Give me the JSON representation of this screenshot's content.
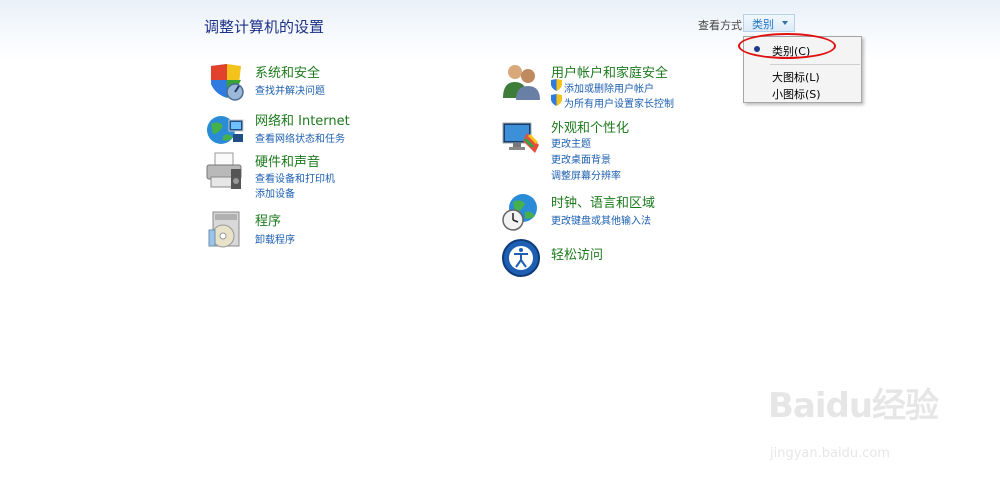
{
  "page": {
    "title": "调整计算机的设置"
  },
  "viewby": {
    "label": "查看方式:",
    "selected": "类别",
    "menu": [
      "类别(C)",
      "大图标(L)",
      "小图标(S)"
    ]
  },
  "categories": [
    {
      "title": "系统和安全",
      "icon": "security-shield-icon",
      "links": [
        "查找并解决问题"
      ]
    },
    {
      "title": "网络和 Internet",
      "icon": "network-globe-icon",
      "links": [
        "查看网络状态和任务"
      ]
    },
    {
      "title": "硬件和声音",
      "icon": "printer-icon",
      "links": [
        "查看设备和打印机",
        "添加设备"
      ]
    },
    {
      "title": "程序",
      "icon": "programs-cd-icon",
      "links": [
        "卸载程序"
      ]
    },
    {
      "title": "用户帐户和家庭安全",
      "icon": "users-icon",
      "links": [
        "添加或删除用户帐户",
        "为所有用户设置家长控制"
      ]
    },
    {
      "title": "外观和个性化",
      "icon": "display-icon",
      "links": [
        "更改主题",
        "更改桌面背景",
        "调整屏幕分辨率"
      ]
    },
    {
      "title": "时钟、语言和区域",
      "icon": "clock-globe-icon",
      "links": [
        "更改键盘或其他输入法"
      ]
    },
    {
      "title": "轻松访问",
      "icon": "ease-of-access-icon",
      "links": []
    }
  ],
  "watermark": {
    "logo": "Baidu经验",
    "url": "jingyan.baidu.com"
  }
}
